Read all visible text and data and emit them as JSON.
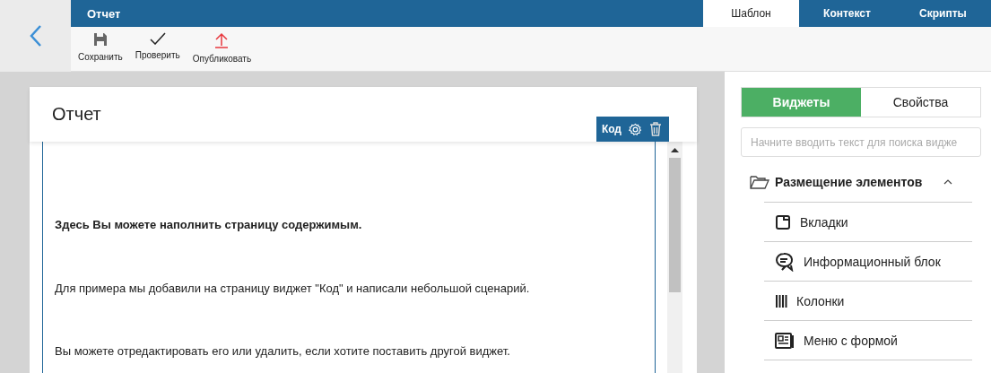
{
  "header": {
    "title": "Отчет"
  },
  "tabs": [
    {
      "label": "Шаблон",
      "selected": true
    },
    {
      "label": "Контекст",
      "selected": false
    },
    {
      "label": "Скрипты",
      "selected": false
    }
  ],
  "toolbar": [
    {
      "label": "Сохранить",
      "kind": "save"
    },
    {
      "label": "Проверить",
      "kind": "check"
    },
    {
      "label": "Опубликовать",
      "kind": "publish"
    }
  ],
  "page": {
    "title": "Отчет",
    "widget_toolbar": {
      "label": "Код"
    },
    "paragraphs": [
      {
        "text": "Здесь Вы можете наполнить страницу содержимым.",
        "bold": true
      },
      {
        "text": "Для примера мы добавили на страницу виджет \"Код\" и написали небольшой сценарий.",
        "bold": false
      },
      {
        "text": "Вы можете отредактировать его или удалить, если хотите поставить другой виджет.",
        "bold": false
      }
    ]
  },
  "panel": {
    "tabs": [
      {
        "label": "Виджеты",
        "selected": true
      },
      {
        "label": "Свойства",
        "selected": false
      }
    ],
    "search": {
      "placeholder": "Начните вводить текст для поиска видже"
    },
    "group": {
      "label": "Размещение элементов",
      "expanded": true,
      "items": [
        {
          "label": "Вкладки",
          "kind": "tabs"
        },
        {
          "label": "Информационный блок",
          "kind": "info"
        },
        {
          "label": "Колонки",
          "kind": "columns"
        },
        {
          "label": "Меню с формой",
          "kind": "form"
        }
      ]
    }
  }
}
